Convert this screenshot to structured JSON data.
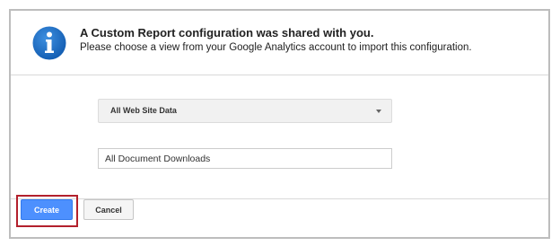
{
  "dialog": {
    "title": "A Custom Report configuration was shared with you.",
    "subtitle": "Please choose a view from your Google Analytics account to import this configuration.",
    "info_icon": "info-icon"
  },
  "form": {
    "view_select": {
      "selected": "All Web Site Data",
      "icon": "chevron-down-icon"
    },
    "report_name": {
      "value": "All Document Downloads"
    }
  },
  "footer": {
    "create_label": "Create",
    "cancel_label": "Cancel"
  },
  "colors": {
    "primary_button": "#4d90fe",
    "info_icon": "#1a6fc9",
    "highlight": "#b3202c"
  }
}
